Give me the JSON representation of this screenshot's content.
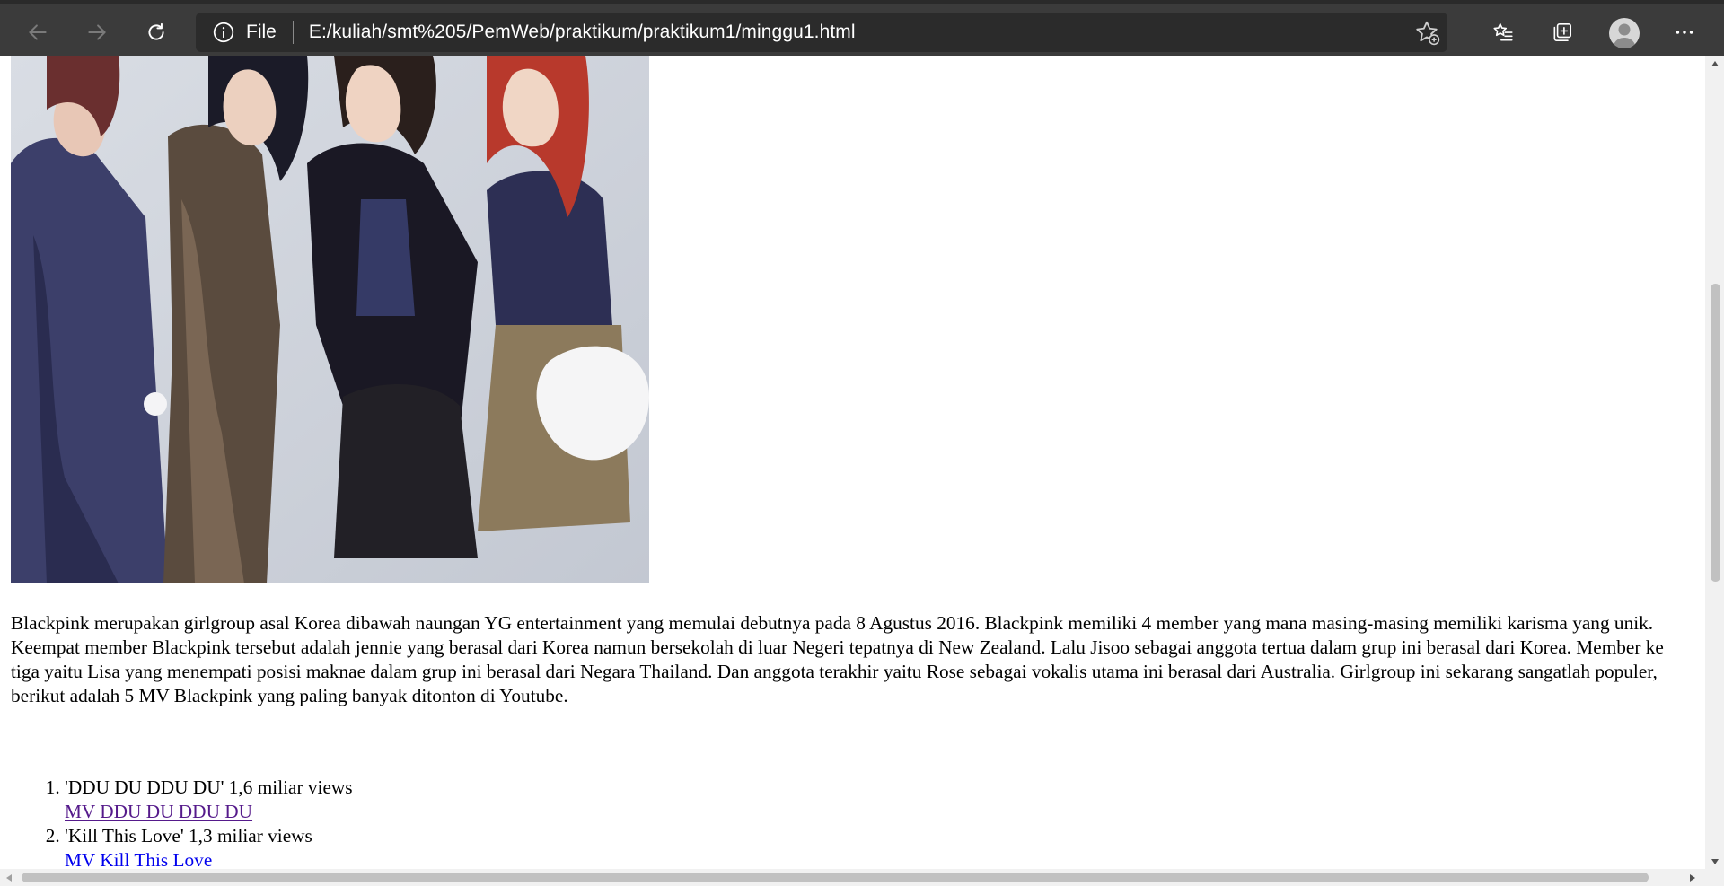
{
  "browser": {
    "address_scheme": "File",
    "address_url": "E:/kuliah/smt%205/PemWeb/praktikum/praktikum1/minggu1.html",
    "colors": {
      "toolbar_bg": "#3b3b3b",
      "address_bg": "#2b2b2b",
      "icon_active": "#ffffff",
      "icon_disabled": "#7a7a7a"
    },
    "icons": [
      "back-icon",
      "forward-icon",
      "refresh-icon",
      "info-icon",
      "add-favorite-icon",
      "favorites-icon",
      "collections-icon",
      "profile-avatar",
      "more-icon"
    ]
  },
  "page": {
    "image_alt": "Blackpink",
    "description": "Blackpink merupakan girlgroup asal Korea dibawah naungan YG entertainment yang memulai debutnya pada 8 Agustus 2016. Blackpink memiliki 4 member yang mana masing-masing memiliki karisma yang unik. Keempat member Blackpink tersebut adalah jennie yang berasal dari Korea namun bersekolah di luar Negeri tepatnya di New Zealand. Lalu Jisoo sebagai anggota tertua dalam grup ini berasal dari Korea. Member ke tiga yaitu Lisa yang menempati posisi maknae dalam grup ini berasal dari Negara Thailand. Dan anggota terakhir yaitu Rose sebagai vokalis utama ini berasal dari Australia. Girlgroup ini sekarang sangatlah populer, berikut adalah 5 MV Blackpink yang paling banyak ditonton di Youtube.",
    "mv_list": [
      {
        "title": "'DDU DU DDU DU' 1,6 miliar views",
        "link": "MV DDU DU DDU DU"
      },
      {
        "title": "'Kill This Love' 1,3 miliar views",
        "link": "MV Kill This Love"
      }
    ],
    "colors": {
      "link_visited": "#551a8b",
      "link": "#0000ee",
      "text": "#000000"
    }
  }
}
